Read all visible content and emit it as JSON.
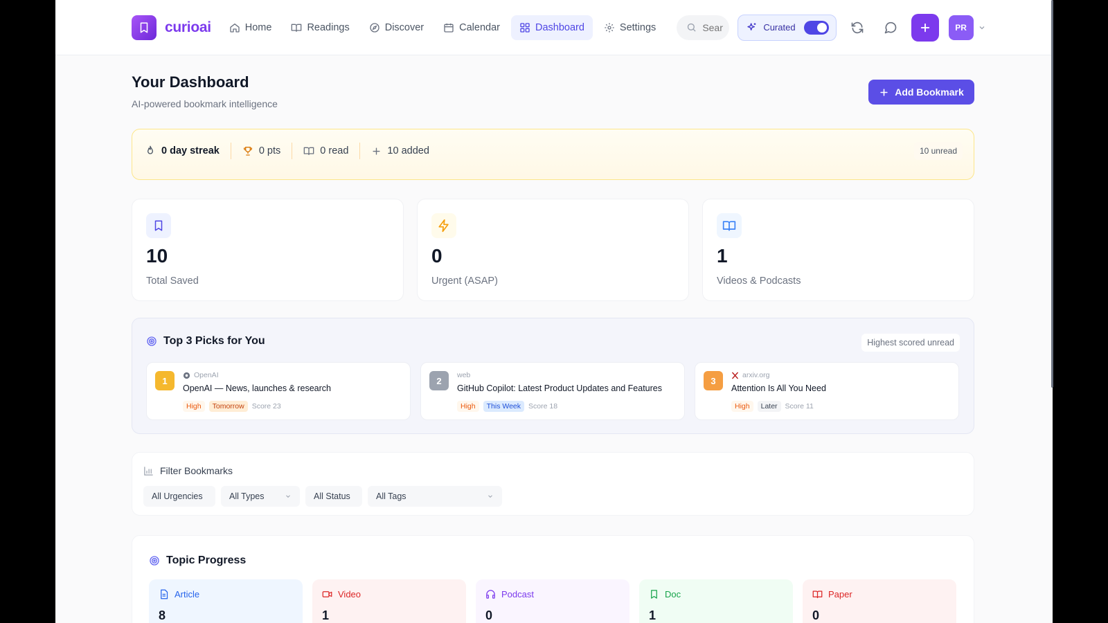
{
  "brand": {
    "name": "curioai"
  },
  "nav": {
    "items": [
      {
        "label": "Home",
        "icon": "home-icon"
      },
      {
        "label": "Readings",
        "icon": "book-open-icon"
      },
      {
        "label": "Discover",
        "icon": "compass-icon"
      },
      {
        "label": "Calendar",
        "icon": "calendar-icon"
      },
      {
        "label": "Dashboard",
        "icon": "grid-icon",
        "active": true
      },
      {
        "label": "Settings",
        "icon": "gear-icon"
      }
    ],
    "search_placeholder": "Search",
    "curated_label": "Curated",
    "curated_on": true,
    "avatar_initials": "PR"
  },
  "header": {
    "title": "Your Dashboard",
    "subtitle": "AI-powered bookmark intelligence",
    "add_button": "Add Bookmark"
  },
  "streak": {
    "streak": "0 day streak",
    "points": "0 pts",
    "read": "0 read",
    "added": "10 added",
    "unread": "10 unread"
  },
  "stats": [
    {
      "value": "10",
      "label": "Total Saved",
      "icon": "bookmark-icon"
    },
    {
      "value": "0",
      "label": "Urgent (ASAP)",
      "icon": "lightning-icon"
    },
    {
      "value": "1",
      "label": "Videos & Podcasts",
      "icon": "book-open-icon"
    }
  ],
  "picks": {
    "title": "Top 3 Picks for You",
    "pill": "Highest scored unread",
    "items": [
      {
        "rank": "1",
        "source": "OpenAI",
        "title": "OpenAI — News, launches & research",
        "priority": "High",
        "when": "Tomorrow",
        "score": "Score 23"
      },
      {
        "rank": "2",
        "source": "web",
        "title": "GitHub Copilot: Latest Product Updates and Features",
        "priority": "High",
        "when": "This Week",
        "score": "Score 18"
      },
      {
        "rank": "3",
        "source": "arxiv.org",
        "title": "Attention Is All You Need",
        "priority": "High",
        "when": "Later",
        "score": "Score 11"
      }
    ]
  },
  "filter": {
    "title": "Filter Bookmarks",
    "urgencies": "All Urgencies",
    "types": "All Types",
    "status": "All Status",
    "tags": "All Tags"
  },
  "topic": {
    "title": "Topic Progress",
    "items": [
      {
        "label": "Article",
        "count": "8"
      },
      {
        "label": "Video",
        "count": "1"
      },
      {
        "label": "Podcast",
        "count": "0"
      },
      {
        "label": "Doc",
        "count": "1"
      },
      {
        "label": "Paper",
        "count": "0"
      }
    ]
  },
  "colors": {
    "accent": "#5b4ee6",
    "brand": "#7c3aed",
    "rank1": "#f5b82e",
    "rank2": "#9ca3af",
    "rank3": "#f59e42"
  }
}
